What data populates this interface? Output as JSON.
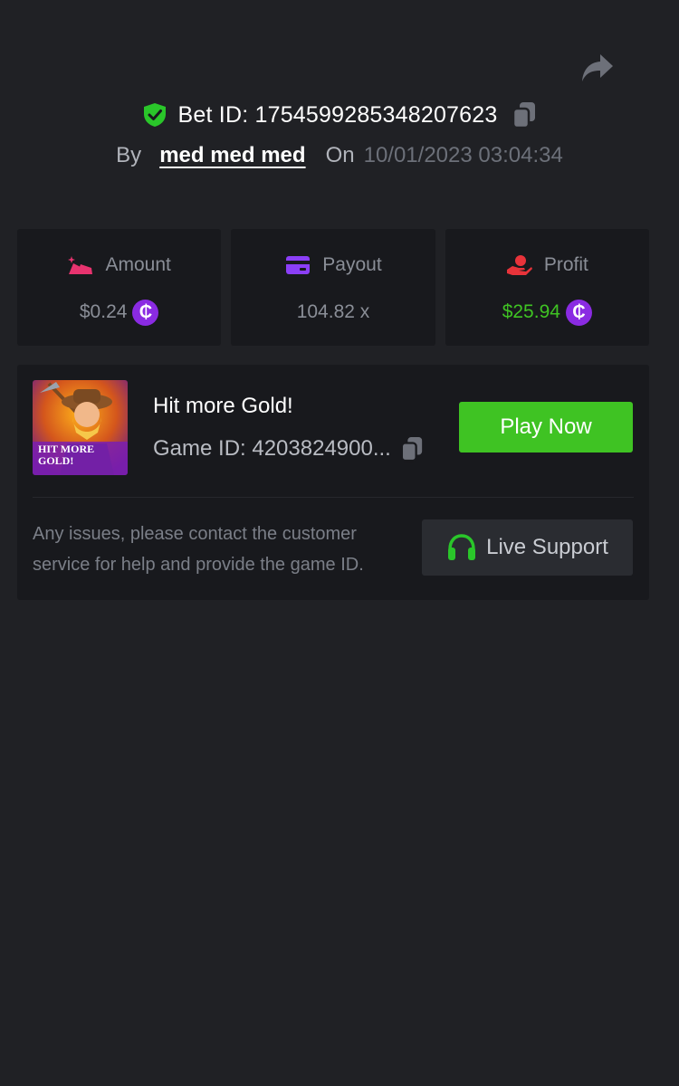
{
  "header": {
    "share_icon": "share-arrow-icon",
    "bet_id_label": "Bet ID: 1754599285348207623",
    "by_label": "By",
    "user_name": "med med med",
    "on_label": "On",
    "date": "10/01/2023 03:04:34"
  },
  "stats": {
    "amount": {
      "label": "Amount",
      "value": "$0.24",
      "icon": "gold-pile-icon",
      "coin": "₵"
    },
    "payout": {
      "label": "Payout",
      "value": "104.82 x",
      "icon": "card-icon"
    },
    "profit": {
      "label": "Profit",
      "value": "$25.94",
      "icon": "hand-coin-icon",
      "coin": "₵"
    }
  },
  "game": {
    "title": "Hit more Gold!",
    "game_id": "Game ID: 4203824900...",
    "play_label": "Play Now",
    "thumb_text_line1": "HIT MORE",
    "thumb_text_line2": "GOLD!",
    "support_text": "Any issues, please contact the customer service for help and provide the game ID.",
    "support_label": "Live Support"
  },
  "colors": {
    "background": "#202125",
    "card": "#18191d",
    "accent_green": "#3fc323",
    "coin_purple": "#8a2be2",
    "amount_pink": "#e8336f",
    "payout_purple": "#8b3ff7",
    "profit_red": "#e8333a"
  }
}
